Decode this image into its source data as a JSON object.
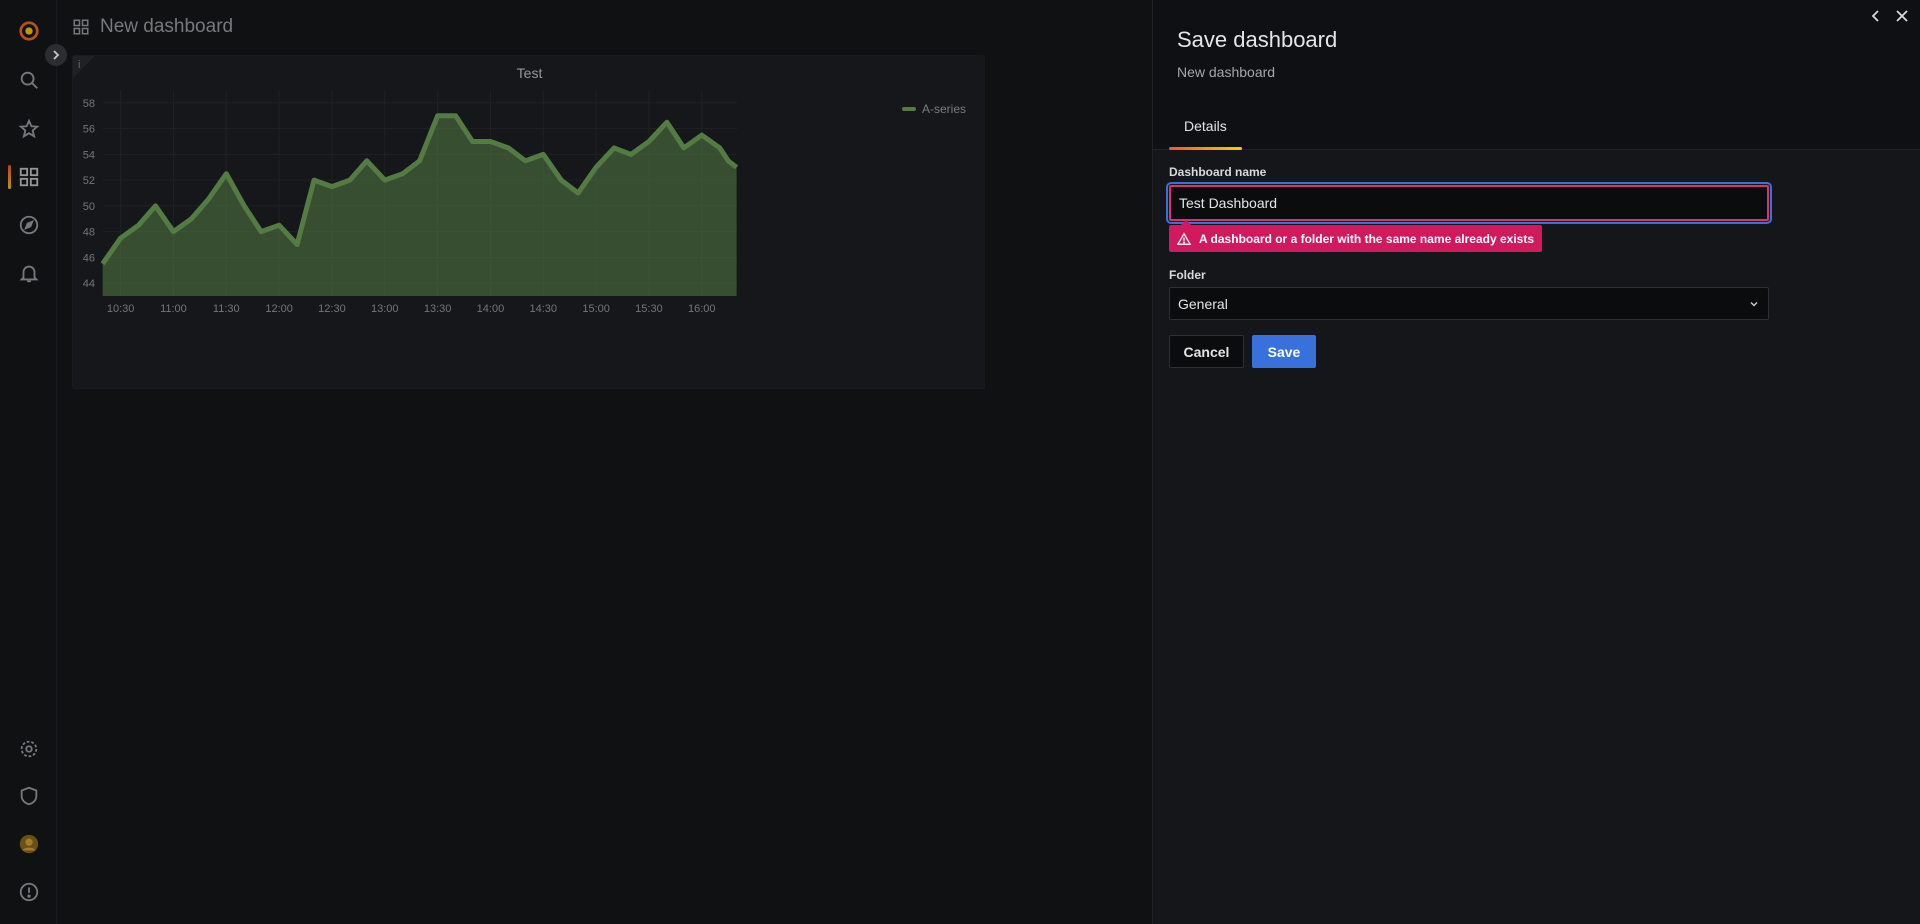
{
  "dashboard": {
    "title": "New dashboard"
  },
  "panel": {
    "title": "Test",
    "info_glyph": "i",
    "legend": "A-series"
  },
  "chart_data": {
    "type": "area",
    "title": "Test",
    "xlabel": "",
    "ylabel": "",
    "x_ticks": [
      "10:30",
      "11:00",
      "11:30",
      "12:00",
      "12:30",
      "13:00",
      "13:30",
      "14:00",
      "14:30",
      "15:00",
      "15:30",
      "16:00"
    ],
    "y_ticks": [
      44,
      46,
      48,
      50,
      52,
      54,
      56,
      58
    ],
    "ylim": [
      43,
      59
    ],
    "x_range": [
      "10:20",
      "16:20"
    ],
    "grid": true,
    "legend_position": "top-right",
    "series": [
      {
        "name": "A-series",
        "color": "#6fa55a",
        "x_hours": [
          10.33,
          10.5,
          10.67,
          10.83,
          11.0,
          11.17,
          11.33,
          11.5,
          11.67,
          11.83,
          12.0,
          12.17,
          12.33,
          12.5,
          12.67,
          12.83,
          13.0,
          13.17,
          13.33,
          13.5,
          13.67,
          13.83,
          14.0,
          14.17,
          14.33,
          14.5,
          14.67,
          14.83,
          15.0,
          15.17,
          15.33,
          15.5,
          15.67,
          15.83,
          16.0,
          16.17,
          16.25,
          16.33
        ],
        "values": [
          45.5,
          47.5,
          48.5,
          50,
          48,
          49,
          50.5,
          52.5,
          50,
          48,
          48.5,
          47,
          52,
          51.5,
          52,
          53.5,
          52,
          52.5,
          53.5,
          57,
          57,
          55,
          55,
          54.5,
          53.5,
          54,
          52,
          51,
          53,
          54.5,
          54,
          55,
          56.5,
          54.5,
          55.5,
          54.5,
          53.5,
          53
        ]
      }
    ]
  },
  "drawer": {
    "title": "Save dashboard",
    "subtitle": "New dashboard",
    "tab": "Details",
    "name_label": "Dashboard name",
    "name_value": "Test Dashboard",
    "error": "A dashboard or a folder with the same name already exists",
    "folder_label": "Folder",
    "folder_value": "General",
    "cancel": "Cancel",
    "save": "Save"
  },
  "colors": {
    "accent_orange": "#f05a28",
    "error_pink": "#d2195e",
    "primary_blue": "#3871dc",
    "series_green": "#6fa55a"
  },
  "icons": {
    "sidebar_top": [
      "grafana-logo-icon",
      "search-icon",
      "star-icon",
      "dashboards-icon",
      "explore-icon",
      "alert-bell-icon"
    ],
    "sidebar_bottom": [
      "gear-icon",
      "shield-icon",
      "user-avatar",
      "help-icon"
    ]
  }
}
